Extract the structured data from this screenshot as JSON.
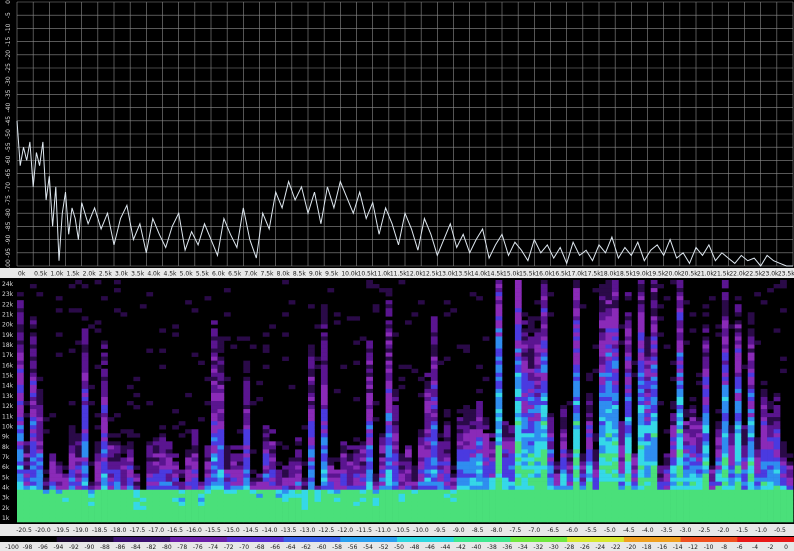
{
  "colors": {
    "background": "#000000",
    "grid": "#8c8c8c",
    "spectrum_line": "#dfe8f0",
    "axis_strip": "#e8e8e8",
    "spectrogram_palette": [
      "#000000",
      "#2a0a48",
      "#5a1590",
      "#8a2ab8",
      "#4a3ae0",
      "#2f8df0",
      "#35d8e8",
      "#4ae07a",
      "#f0e040",
      "#f08020",
      "#e82020"
    ]
  },
  "chart_data": [
    {
      "type": "line",
      "title": "",
      "xlabel": "",
      "ylabel": "",
      "xlim": [
        0,
        24000
      ],
      "ylim": [
        -100,
        0
      ],
      "grid": true,
      "x_tick_labels": [
        "0k",
        "0.5k",
        "1.0k",
        "1.5k",
        "2.0k",
        "2.5k",
        "3.0k",
        "3.5k",
        "4.0k",
        "4.5k",
        "5.0k",
        "5.5k",
        "6.0k",
        "6.5k",
        "7.0k",
        "7.5k",
        "8.0k",
        "8.5k",
        "9.0k",
        "9.5k",
        "10.0k",
        "10.5k",
        "11.0k",
        "11.5k",
        "12.0k",
        "12.5k",
        "13.0k",
        "13.5k",
        "14.0k",
        "14.5k",
        "15.0k",
        "15.5k",
        "16.0k",
        "16.5k",
        "17.0k",
        "17.5k",
        "18.0k",
        "18.5k",
        "19.0k",
        "19.5k",
        "20.0k",
        "20.5k",
        "21.0k",
        "21.5k",
        "22.0k",
        "22.5k",
        "23.0k",
        "23.5k",
        "24."
      ],
      "y_tick_labels": [
        "0",
        "-5",
        "-10",
        "-15",
        "-20",
        "-25",
        "-30",
        "-35",
        "-40",
        "-45",
        "-50",
        "-55",
        "-60",
        "-65",
        "-70",
        "-75",
        "-80",
        "-85",
        "-90",
        "-95",
        "-100"
      ],
      "series": [
        {
          "x": [
            0,
            100,
            200,
            300,
            400,
            500,
            600,
            700,
            800,
            900,
            1000,
            1100,
            1200,
            1300,
            1400,
            1500,
            1600,
            1700,
            1800,
            1900,
            2000,
            2200,
            2400,
            2600,
            2800,
            3000,
            3200,
            3400,
            3600,
            3800,
            4000,
            4200,
            4400,
            4600,
            4800,
            5000,
            5200,
            5400,
            5600,
            5800,
            6000,
            6200,
            6400,
            6600,
            6800,
            7000,
            7200,
            7400,
            7600,
            7800,
            8000,
            8200,
            8400,
            8600,
            8800,
            9000,
            9200,
            9400,
            9600,
            9800,
            10000,
            10200,
            10400,
            10600,
            10800,
            11000,
            11200,
            11400,
            11600,
            11800,
            12000,
            12200,
            12400,
            12600,
            12800,
            13000,
            13200,
            13400,
            13600,
            13800,
            14000,
            14200,
            14400,
            14600,
            14800,
            15000,
            15200,
            15400,
            15600,
            15800,
            16000,
            16200,
            16400,
            16600,
            16800,
            17000,
            17200,
            17400,
            17600,
            17800,
            18000,
            18200,
            18400,
            18600,
            18800,
            19000,
            19200,
            19400,
            19600,
            19800,
            20000,
            20200,
            20400,
            20600,
            20800,
            21000,
            21200,
            21400,
            21600,
            21800,
            22000,
            22200,
            22400,
            22600,
            22800,
            23000,
            23200,
            23400,
            23600,
            23800,
            24000
          ],
          "y": [
            -45,
            -62,
            -55,
            -60,
            -53,
            -70,
            -57,
            -62,
            -53,
            -75,
            -66,
            -85,
            -70,
            -98,
            -80,
            -72,
            -88,
            -78,
            -82,
            -90,
            -76,
            -84,
            -78,
            -86,
            -80,
            -92,
            -82,
            -77,
            -90,
            -84,
            -95,
            -82,
            -88,
            -93,
            -85,
            -80,
            -94,
            -87,
            -92,
            -84,
            -90,
            -96,
            -82,
            -88,
            -93,
            -78,
            -90,
            -97,
            -80,
            -86,
            -72,
            -78,
            -68,
            -75,
            -70,
            -80,
            -72,
            -84,
            -70,
            -78,
            -68,
            -74,
            -80,
            -72,
            -82,
            -76,
            -88,
            -78,
            -84,
            -92,
            -80,
            -86,
            -94,
            -82,
            -88,
            -96,
            -90,
            -84,
            -93,
            -88,
            -95,
            -90,
            -86,
            -97,
            -92,
            -88,
            -96,
            -91,
            -94,
            -98,
            -90,
            -95,
            -92,
            -97,
            -93,
            -99,
            -91,
            -96,
            -94,
            -98,
            -92,
            -95,
            -89,
            -97,
            -93,
            -96,
            -91,
            -98,
            -94,
            -92,
            -96,
            -90,
            -97,
            -95,
            -99,
            -93,
            -96,
            -92,
            -98,
            -95,
            -97,
            -99,
            -96,
            -98,
            -97,
            -100,
            -96,
            -98,
            -99,
            -100,
            -100
          ]
        }
      ]
    },
    {
      "type": "heatmap",
      "title": "",
      "xlabel": "",
      "ylabel": "",
      "x_tick_labels": [
        "-20.5",
        "-20.0",
        "-19.5",
        "-19.0",
        "-18.5",
        "-18.0",
        "-17.5",
        "-17.0",
        "-16.5",
        "-16.0",
        "-15.5",
        "-15.0",
        "-14.5",
        "-14.0",
        "-13.5",
        "-13.0",
        "-12.5",
        "-12.0",
        "-11.5",
        "-11.0",
        "-10.5",
        "-10.0",
        "-9.5",
        "-9.0",
        "-8.5",
        "-8.0",
        "-7.5",
        "-7.0",
        "-6.5",
        "-6.0",
        "-5.5",
        "-5.0",
        "-4.5",
        "-4.0",
        "-3.5",
        "-3.0",
        "-2.5",
        "-2.0",
        "-1.5",
        "-1.0",
        "-0.5"
      ],
      "y_tick_labels": [
        "24k",
        "23k",
        "22k",
        "21k",
        "20k",
        "19k",
        "18k",
        "17k",
        "16k",
        "15k",
        "14k",
        "13k",
        "12k",
        "11k",
        "10k",
        "9k",
        "8k",
        "7k",
        "6k",
        "5k",
        "4k",
        "3k",
        "2k",
        "1k"
      ],
      "colorbar_labels": [
        "-100",
        "-98",
        "-96",
        "-94",
        "-92",
        "-90",
        "-88",
        "-86",
        "-84",
        "-82",
        "-80",
        "-78",
        "-76",
        "-74",
        "-72",
        "-70",
        "-68",
        "-66",
        "-64",
        "-62",
        "-60",
        "-58",
        "-56",
        "-54",
        "-52",
        "-50",
        "-48",
        "-46",
        "-44",
        "-42",
        "-40",
        "-38",
        "-36",
        "-34",
        "-32",
        "-30",
        "-28",
        "-26",
        "-24",
        "-22",
        "-20",
        "-18",
        "-16",
        "-14",
        "-12",
        "-10",
        "-8",
        "-6",
        "-4",
        "-2",
        "0"
      ],
      "loud_segment_start_label": "-7.0",
      "transient_columns": 120
    }
  ]
}
